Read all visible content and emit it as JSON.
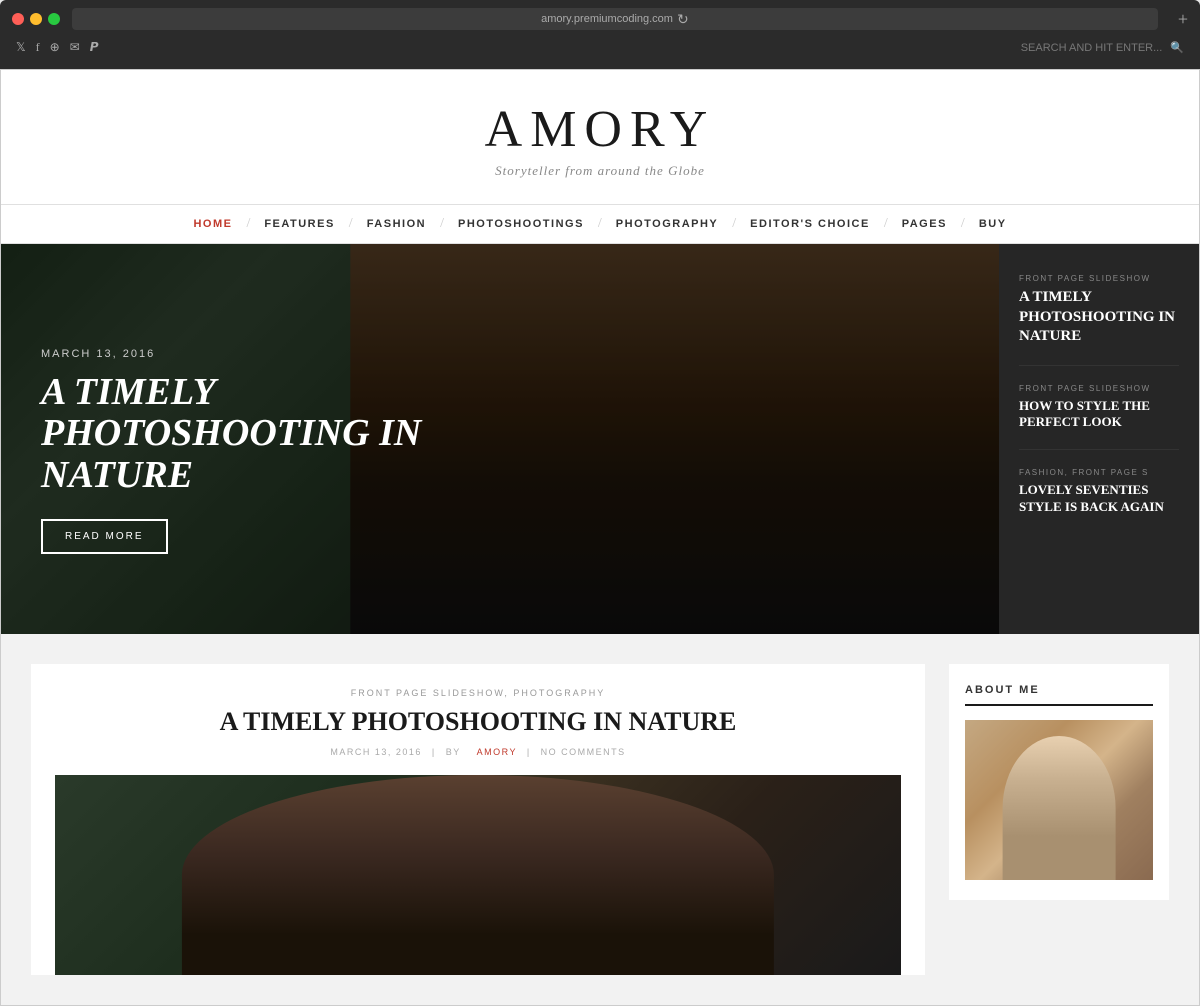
{
  "browser": {
    "url": "amory.premiumcoding.com",
    "search_placeholder": "SEARCH AND HIT ENTER...",
    "dots": [
      "red",
      "yellow",
      "green"
    ]
  },
  "site": {
    "title": "AMORY",
    "subtitle": "Storyteller from around the Globe"
  },
  "nav": {
    "items": [
      {
        "label": "HOME",
        "active": true
      },
      {
        "label": "FEATURES",
        "active": false
      },
      {
        "label": "FASHION",
        "active": false
      },
      {
        "label": "PHOTOSHOOTINGS",
        "active": false
      },
      {
        "label": "PHOTOGRAPHY",
        "active": false
      },
      {
        "label": "EDITOR'S CHOICE",
        "active": false
      },
      {
        "label": "PAGES",
        "active": false
      },
      {
        "label": "BUY",
        "active": false
      }
    ]
  },
  "hero": {
    "date": "MARCH 13, 2016",
    "title": "A TIMELY PHOTOSHOOTING IN NATURE",
    "read_more": "READ MORE",
    "sidebar": {
      "items": [
        {
          "category": "FRONT PAGE SLIDESHOW",
          "title": "A TIMELY PHOTOSHOOTING IN NATURE",
          "featured": true
        },
        {
          "category": "FRONT PAGE SLIDESHOW",
          "title": "HOW TO STYLE THE PERFECT LOOK",
          "featured": false
        },
        {
          "category": "FASHION, FRONT PAGE S",
          "title": "LOVELY SEVENTIES STYLE IS BACK AGAIN",
          "featured": false
        }
      ]
    }
  },
  "article": {
    "categories": "FRONT PAGE SLIDESHOW, PHOTOGRAPHY",
    "title": "A TIMELY PHOTOSHOOTING IN NATURE",
    "date": "MARCH 13, 2016",
    "by_label": "BY",
    "author": "AMORY",
    "comments": "NO COMMENTS"
  },
  "about": {
    "title": "ABOUT ME"
  }
}
